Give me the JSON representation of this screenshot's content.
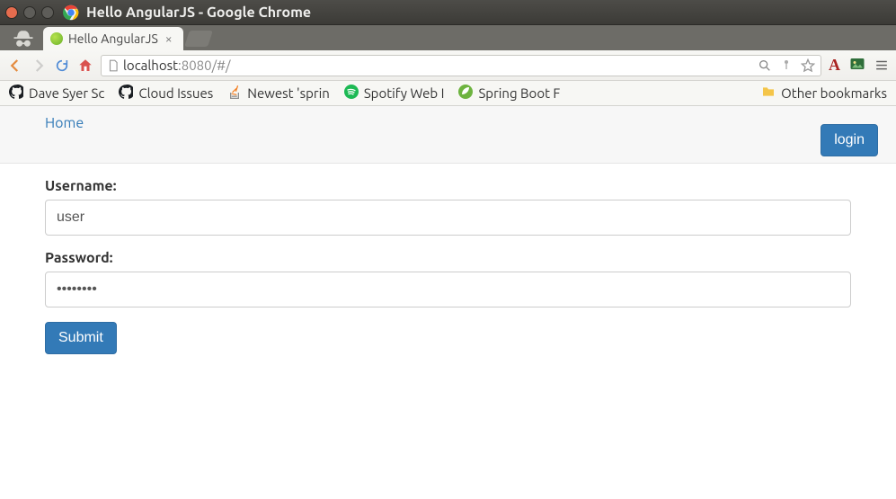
{
  "window": {
    "title": "Hello AngularJS - Google Chrome"
  },
  "tabs": [
    {
      "title": "Hello AngularJS"
    }
  ],
  "url": {
    "host": "localhost",
    "port_path": ":8080/#/"
  },
  "bookmarks": {
    "items": [
      {
        "label": "Dave Syer Sc"
      },
      {
        "label": "Cloud Issues"
      },
      {
        "label": "Newest 'sprin"
      },
      {
        "label": "Spotify Web I"
      },
      {
        "label": "Spring Boot F"
      }
    ],
    "other_label": "Other bookmarks"
  },
  "page": {
    "home_label": "Home",
    "login_label": "login",
    "form": {
      "username_label": "Username:",
      "username_value": "user",
      "password_label": "Password:",
      "password_value": "password",
      "submit_label": "Submit"
    }
  }
}
